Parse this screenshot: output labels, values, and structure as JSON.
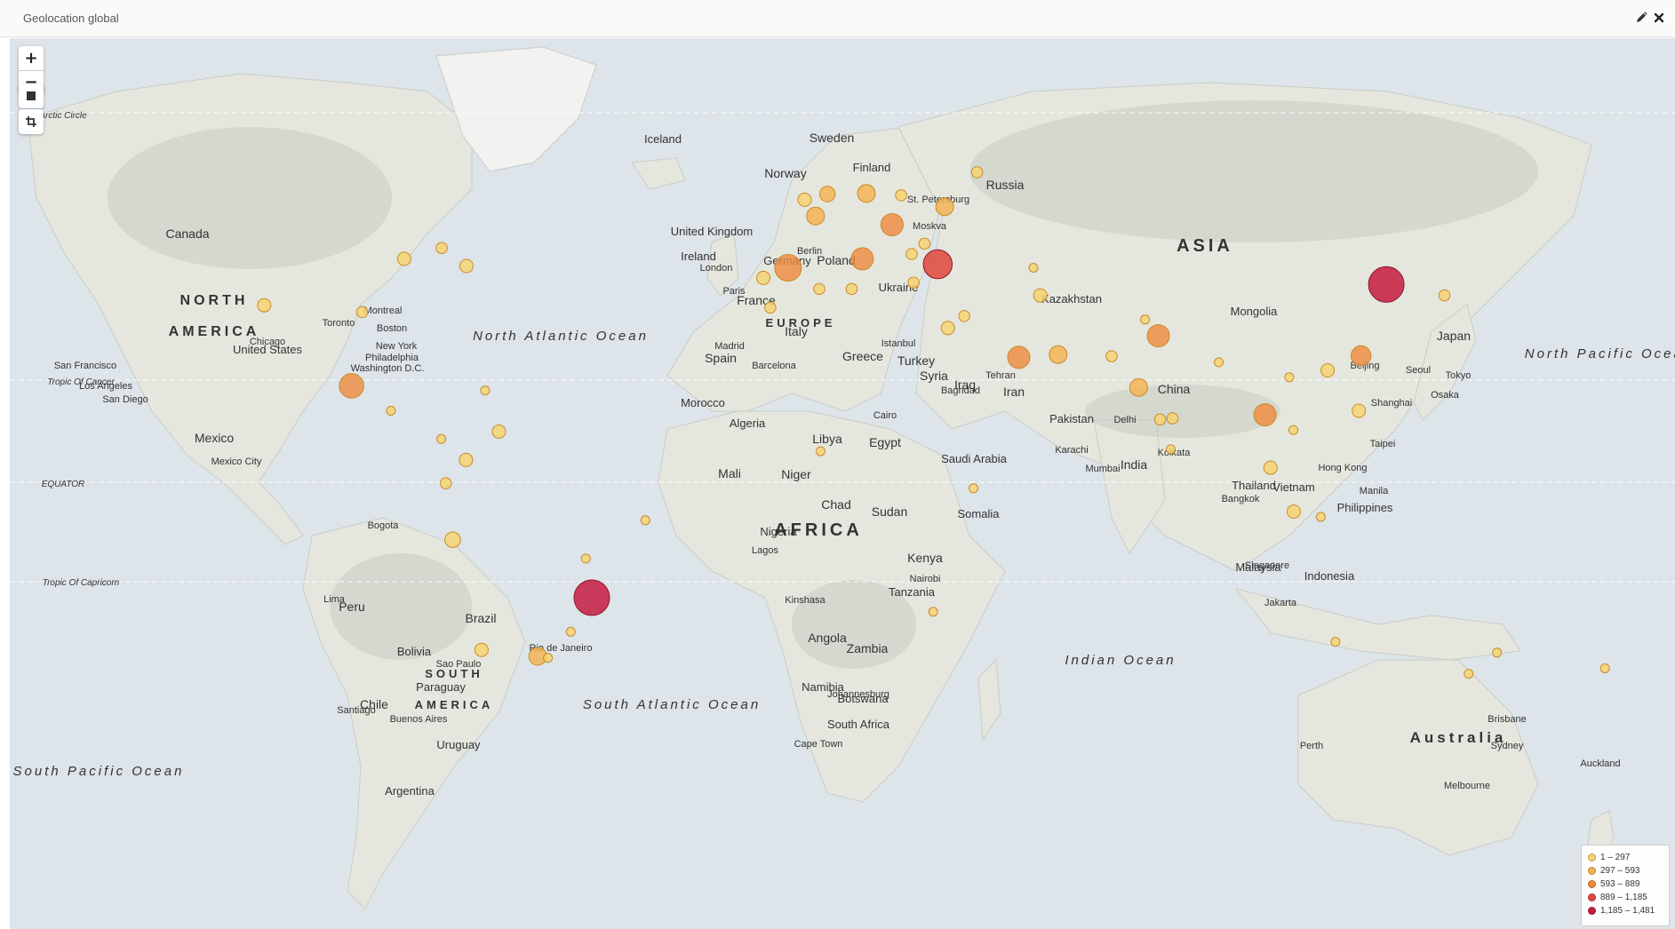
{
  "panel": {
    "title": "Geolocation global"
  },
  "controls": {
    "zoom_in": "+",
    "zoom_out": "−"
  },
  "icons": {
    "edit": "pencil-icon",
    "close": "close-icon",
    "draw_rectangle": "square-icon",
    "crop": "crop-icon"
  },
  "colors": {
    "ocean": "#dde4ea",
    "land": "#e6e8df",
    "land_shade": "#c9cec3",
    "bin1": "#f7d36b",
    "bin2": "#f5b24c",
    "bin3": "#ef8a3c",
    "bin4": "#e0473a",
    "bin5": "#c61b3f"
  },
  "legend": [
    {
      "label": "1 – 297",
      "bin": 1
    },
    {
      "label": "297 – 593",
      "bin": 2
    },
    {
      "label": "593 – 889",
      "bin": 3
    },
    {
      "label": "889 – 1,185",
      "bin": 4
    },
    {
      "label": "1,185 – 1,481",
      "bin": 5
    }
  ],
  "map": {
    "regions": [
      "NORTH",
      "AMERICA",
      "SOUTH",
      "AMERICA",
      "EUROPE",
      "AFRICA",
      "ASIA",
      "Australia"
    ],
    "countries": [
      "Canada",
      "United States",
      "Mexico",
      "Brazil",
      "Peru",
      "Bolivia",
      "Paraguay",
      "Uruguay",
      "Argentina",
      "Chile",
      "Russia",
      "China",
      "India",
      "Kazakhstan",
      "Mongolia",
      "Iran",
      "Iraq",
      "Egypt",
      "Libya",
      "Algeria",
      "Morocco",
      "Mali",
      "Niger",
      "Chad",
      "Sudan",
      "Nigeria",
      "Kenya",
      "Tanzania",
      "Angola",
      "Zambia",
      "Namibia",
      "Botswana",
      "Somalia",
      "Saudi Arabia",
      "Turkey",
      "Syria",
      "Ukraine",
      "Poland",
      "Germany",
      "France",
      "Spain",
      "Italy",
      "United Kingdom",
      "Ireland",
      "Norway",
      "Sweden",
      "Finland",
      "Iceland",
      "Japan",
      "Indonesia",
      "Philippines",
      "Malaysia",
      "Thailand",
      "Vietnam",
      "Pakistan",
      "South Africa",
      "Greece"
    ],
    "cities": [
      "Chicago",
      "New York",
      "Philadelphia",
      "Washington D.C.",
      "San Francisco",
      "Los Angeles",
      "San Diego",
      "Boston",
      "Montreal",
      "Toronto",
      "Mexico City",
      "Bogota",
      "Lima",
      "Sao Paulo",
      "Rio de Janeiro",
      "Buenos Aires",
      "Santiago",
      "London",
      "Paris",
      "Madrid",
      "Barcelona",
      "Berlin",
      "Moskva",
      "St. Petersburg",
      "Istanbul",
      "Tehran",
      "Cairo",
      "Baghdad",
      "Lagos",
      "Kinshasa",
      "Nairobi",
      "Johannesburg",
      "Cape Town",
      "Delhi",
      "Mumbai",
      "Kolkata",
      "Karachi",
      "Beijing",
      "Seoul",
      "Tokyo",
      "Osaka",
      "Shanghai",
      "Taipei",
      "Hong Kong",
      "Manila",
      "Bangkok",
      "Jakarta",
      "Singapore",
      "Sydney",
      "Melbourne",
      "Perth",
      "Brisbane",
      "Auckland"
    ],
    "oceans": [
      "North Atlantic Ocean",
      "South Atlantic Ocean",
      "Indian Ocean",
      "South Pacific Ocean",
      "North Pacific Ocean"
    ],
    "lines": [
      "Arctic Circle",
      "Tropic Of Cancer",
      "EQUATOR",
      "Tropic Of Capricorn"
    ]
  },
  "markers": [
    {
      "name": "Mexico City",
      "lat": 19.4,
      "lon": -99.1,
      "bin": 3,
      "size": 11
    },
    {
      "name": "Sao Paulo",
      "lat": -23.5,
      "lon": -46.6,
      "bin": 5,
      "size": 16
    },
    {
      "name": "Madrid",
      "lat": 40.4,
      "lon": -3.7,
      "bin": 3,
      "size": 12
    },
    {
      "name": "Istanbul",
      "lat": 41.0,
      "lon": 29.0,
      "bin": 4,
      "size": 13
    },
    {
      "name": "Seoul",
      "lat": 37.6,
      "lon": 127.0,
      "bin": 5,
      "size": 16
    },
    {
      "name": "Bangkok",
      "lat": 13.8,
      "lon": 100.5,
      "bin": 3,
      "size": 10
    },
    {
      "name": "Delhi",
      "lat": 28.6,
      "lon": 77.2,
      "bin": 3,
      "size": 10
    },
    {
      "name": "Rome",
      "lat": 41.9,
      "lon": 12.5,
      "bin": 3,
      "size": 10
    },
    {
      "name": "Budapest",
      "lat": 47.5,
      "lon": 19.0,
      "bin": 3,
      "size": 10
    },
    {
      "name": "Riyadh",
      "lat": 24.7,
      "lon": 46.7,
      "bin": 3,
      "size": 10
    },
    {
      "name": "Taipei",
      "lat": 25.0,
      "lon": 121.5,
      "bin": 3,
      "size": 9
    },
    {
      "name": "Buenos Aires",
      "lat": -34.6,
      "lon": -58.4,
      "bin": 2,
      "size": 8
    },
    {
      "name": "Paris",
      "lat": 48.9,
      "lon": 2.3,
      "bin": 2,
      "size": 8
    },
    {
      "name": "Berlin",
      "lat": 52.5,
      "lon": 13.4,
      "bin": 2,
      "size": 8
    },
    {
      "name": "Amsterdam",
      "lat": 52.4,
      "lon": 4.9,
      "bin": 2,
      "size": 7
    },
    {
      "name": "Kyiv",
      "lat": 50.4,
      "lon": 30.5,
      "bin": 2,
      "size": 8
    },
    {
      "name": "Dubai",
      "lat": 25.2,
      "lon": 55.3,
      "bin": 2,
      "size": 8
    },
    {
      "name": "Mumbai",
      "lat": 19.1,
      "lon": 72.9,
      "bin": 2,
      "size": 8
    },
    {
      "name": "Caracas",
      "lat": 10.5,
      "lon": -66.9,
      "bin": 1,
      "size": 6
    },
    {
      "name": "Bogota",
      "lat": 4.7,
      "lon": -74.1,
      "bin": 1,
      "size": 6
    },
    {
      "name": "Lima",
      "lat": -12.0,
      "lon": -77.0,
      "bin": 1,
      "size": 7
    },
    {
      "name": "Santiago",
      "lat": -33.4,
      "lon": -70.7,
      "bin": 1,
      "size": 6
    },
    {
      "name": "London",
      "lat": 51.5,
      "lon": -0.1,
      "bin": 1,
      "size": 6
    },
    {
      "name": "Lisboa",
      "lat": 38.7,
      "lon": -9.1,
      "bin": 1,
      "size": 6
    },
    {
      "name": "Cairo",
      "lat": 30.0,
      "lon": 31.2,
      "bin": 1,
      "size": 6
    },
    {
      "name": "Hong Kong",
      "lat": 22.3,
      "lon": 114.2,
      "bin": 1,
      "size": 6
    },
    {
      "name": "Jakarta",
      "lat": -6.2,
      "lon": 106.8,
      "bin": 1,
      "size": 6
    },
    {
      "name": "Kuala Lumpur",
      "lat": 3.1,
      "lon": 101.7,
      "bin": 1,
      "size": 6
    },
    {
      "name": "Manila",
      "lat": 14.6,
      "lon": 121.0,
      "bin": 1,
      "size": 6
    },
    {
      "name": "Chicago",
      "lat": 41.9,
      "lon": -87.6,
      "bin": 1,
      "size": 6
    },
    {
      "name": "New York",
      "lat": 40.7,
      "lon": -74.0,
      "bin": 1,
      "size": 6
    },
    {
      "name": "Los Angeles",
      "lat": 34.0,
      "lon": -118.2,
      "bin": 1,
      "size": 6
    },
    {
      "name": "Dallas",
      "lat": 32.8,
      "lon": -96.8,
      "bin": 1,
      "size": 5
    },
    {
      "name": "Toronto",
      "lat": 43.7,
      "lon": -79.4,
      "bin": 1,
      "size": 5
    },
    {
      "name": "Tehran",
      "lat": 35.7,
      "lon": 51.4,
      "bin": 1,
      "size": 6
    },
    {
      "name": "Karachi",
      "lat": 24.9,
      "lon": 67.0,
      "bin": 1,
      "size": 5
    },
    {
      "name": "Chennai",
      "lat": 13.1,
      "lon": 80.3,
      "bin": 1,
      "size": 5
    },
    {
      "name": "Bengaluru",
      "lat": 12.9,
      "lon": 77.6,
      "bin": 1,
      "size": 5
    },
    {
      "name": "Moskva",
      "lat": 55.8,
      "lon": 37.6,
      "bin": 1,
      "size": 5
    },
    {
      "name": "Sofia",
      "lat": 42.7,
      "lon": 23.3,
      "bin": 1,
      "size": 5
    },
    {
      "name": "Athens",
      "lat": 37.9,
      "lon": 23.7,
      "bin": 1,
      "size": 5
    },
    {
      "name": "Tel Aviv",
      "lat": 32.1,
      "lon": 34.8,
      "bin": 1,
      "size": 5
    },
    {
      "name": "Casablanca",
      "lat": 33.6,
      "lon": -7.6,
      "bin": 1,
      "size": 5
    },
    {
      "name": "Algiers",
      "lat": 36.8,
      "lon": 3.1,
      "bin": 1,
      "size": 5
    },
    {
      "name": "Tunis",
      "lat": 36.8,
      "lon": 10.2,
      "bin": 1,
      "size": 5
    },
    {
      "name": "Lagos",
      "lat": 6.5,
      "lon": 3.4,
      "bin": 1,
      "size": 4
    },
    {
      "name": "Nairobi",
      "lat": -1.3,
      "lon": 36.8,
      "bin": 1,
      "size": 4
    },
    {
      "name": "Johannesburg",
      "lat": -26.2,
      "lon": 28.0,
      "bin": 1,
      "size": 4
    },
    {
      "name": "Sydney",
      "lat": -33.9,
      "lon": 151.2,
      "bin": 1,
      "size": 4
    },
    {
      "name": "Melbourne",
      "lat": -37.8,
      "lon": 145.0,
      "bin": 1,
      "size": 4
    },
    {
      "name": "Tokyo",
      "lat": 35.7,
      "lon": 139.7,
      "bin": 1,
      "size": 5
    },
    {
      "name": "Montevideo",
      "lat": -34.9,
      "lon": -56.2,
      "bin": 1,
      "size": 4
    },
    {
      "name": "Quito",
      "lat": -0.2,
      "lon": -78.5,
      "bin": 1,
      "size": 5
    },
    {
      "name": "Panama",
      "lat": 9.0,
      "lon": -79.5,
      "bin": 1,
      "size": 4
    },
    {
      "name": "Guatemala",
      "lat": 14.6,
      "lon": -90.5,
      "bin": 1,
      "size": 4
    },
    {
      "name": "Santo Domingo",
      "lat": 18.5,
      "lon": -69.9,
      "bin": 1,
      "size": 4
    },
    {
      "name": "Dhaka",
      "lat": 23.8,
      "lon": 90.4,
      "bin": 1,
      "size": 4
    },
    {
      "name": "Colombo",
      "lat": 6.9,
      "lon": 79.9,
      "bin": 1,
      "size": 4
    },
    {
      "name": "Porto Alegre",
      "lat": -30.0,
      "lon": -51.2,
      "bin": 1,
      "size": 4
    },
    {
      "name": "Recife",
      "lat": -8.0,
      "lon": -34.9,
      "bin": 1,
      "size": 4
    },
    {
      "name": "Brasilia",
      "lat": -15.8,
      "lon": -47.9,
      "bin": 1,
      "size": 4
    },
    {
      "name": "Auckland",
      "lat": -36.8,
      "lon": 174.8,
      "bin": 1,
      "size": 4
    },
    {
      "name": "Perth",
      "lat": -31.9,
      "lon": 115.9,
      "bin": 1,
      "size": 4
    },
    {
      "name": "Ho Chi Minh",
      "lat": 10.8,
      "lon": 106.7,
      "bin": 1,
      "size": 4
    },
    {
      "name": "Hanoi",
      "lat": 21.0,
      "lon": 105.8,
      "bin": 1,
      "size": 4
    },
    {
      "name": "Surabaya",
      "lat": -7.3,
      "lon": 112.7,
      "bin": 1,
      "size": 4
    },
    {
      "name": "Warsaw",
      "lat": 52.2,
      "lon": 21.0,
      "bin": 1,
      "size": 5
    },
    {
      "name": "Bucharest",
      "lat": 44.4,
      "lon": 26.1,
      "bin": 1,
      "size": 5
    },
    {
      "name": "Baku",
      "lat": 40.4,
      "lon": 49.9,
      "bin": 1,
      "size": 4
    },
    {
      "name": "Lahore",
      "lat": 31.5,
      "lon": 74.3,
      "bin": 1,
      "size": 4
    }
  ]
}
